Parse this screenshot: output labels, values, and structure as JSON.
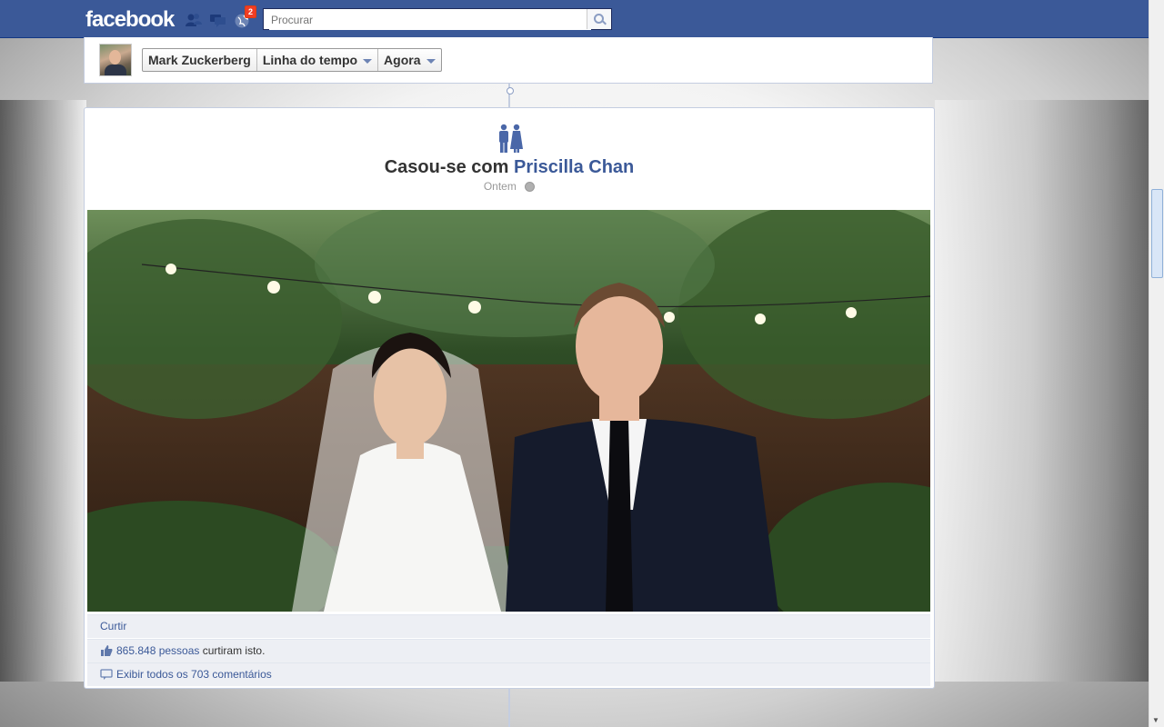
{
  "topbar": {
    "logo": "facebook",
    "notification_count": "2",
    "search_placeholder": "Procurar",
    "jewels": [
      "friend-requests-icon",
      "messages-icon",
      "notifications-icon"
    ]
  },
  "timeline_header": {
    "profile_name": "Mark Zuckerberg",
    "timeline_label": "Linha do tempo",
    "period_label": "Agora"
  },
  "story": {
    "title_prefix": "Casou-se com",
    "partner_name": "Priscilla Chan",
    "date": "Ontem",
    "like_action": "Curtir",
    "likes_count": "865.848 pessoas",
    "likes_suffix": "curtiram isto.",
    "comments_link": "Exibir todos os 703 comentários"
  },
  "colors": {
    "brand_blue": "#3b5998",
    "link_blue": "#3b5998",
    "badge_red": "#f03d25"
  }
}
